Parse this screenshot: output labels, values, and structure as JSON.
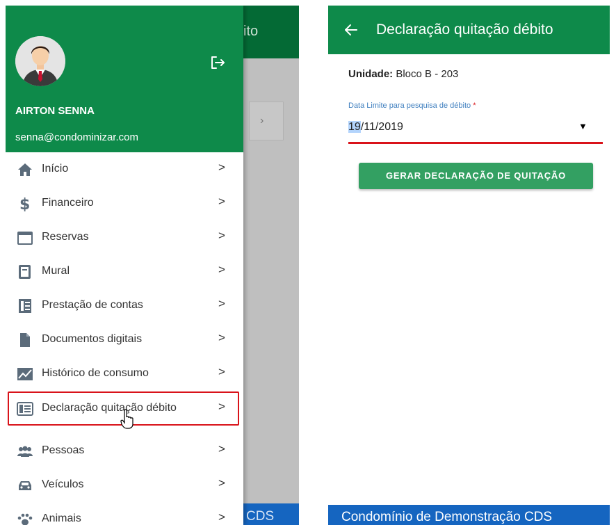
{
  "background_screen": {
    "title_fragment": "ito",
    "footer_fragment": "CDS",
    "chip_chevron": "›"
  },
  "drawer": {
    "user": {
      "name": "AIRTON SENNA",
      "email": "senna@condominizar.com"
    },
    "logout_icon": "logout-icon",
    "items": [
      {
        "label": "Início",
        "icon": "home-icon"
      },
      {
        "label": "Financeiro",
        "icon": "dollar-icon"
      },
      {
        "label": "Reservas",
        "icon": "calendar-icon"
      },
      {
        "label": "Mural",
        "icon": "board-icon"
      },
      {
        "label": "Prestação de contas",
        "icon": "report-icon"
      },
      {
        "label": "Documentos digitais",
        "icon": "document-icon"
      },
      {
        "label": "Histórico de consumo",
        "icon": "chart-icon"
      },
      {
        "label": "Declaração quitação débito",
        "icon": "declaration-icon",
        "active": true
      },
      {
        "label": "Pessoas",
        "icon": "people-icon"
      },
      {
        "label": "Veículos",
        "icon": "car-icon"
      },
      {
        "label": "Animais",
        "icon": "paw-icon"
      }
    ],
    "chevron": ">"
  },
  "screen": {
    "title": "Declaração quitação débito",
    "unit_label": "Unidade:",
    "unit_value": "Bloco B - 203",
    "date_label": "Data Limite para pesquisa de débito",
    "date_required_mark": "*",
    "date_value_selected": "19",
    "date_value_rest": "/11/2019",
    "dropdown_caret": "▼",
    "button_label": "GERAR DECLARAÇÃO DE QUITAÇÃO",
    "footer": "Condomínio de Demonstração CDS"
  },
  "colors": {
    "primary_green": "#0e8a4a",
    "button_green": "#33a062",
    "footer_blue": "#1565c0",
    "highlight_red": "#d9131a"
  }
}
